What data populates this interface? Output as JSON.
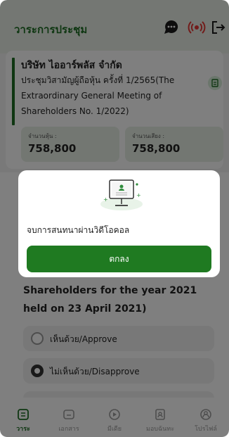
{
  "header": {
    "title": "วาระการประชุม"
  },
  "company": {
    "name": "บริษัท ไออาร์พลัส จำกัด",
    "meeting": "ประชุมวิสามัญผู้ถือหุ้น ครั้งที่ 1/2565(The Extraordinary General Meeting of Shareholders No. 1/2022)"
  },
  "stats": [
    {
      "label": "จำนวนหุ้น :",
      "value": "758,800"
    },
    {
      "label": "จำนวนเสียง :",
      "value": "758,800"
    }
  ],
  "agenda": {
    "text": "Shareholders for the year 2021 held on 23 April 2021)",
    "options": [
      {
        "label": "เห็นด้วย/Approve",
        "selected": false
      },
      {
        "label": "ไม่เห็นด้วย/Disapprove",
        "selected": true
      }
    ]
  },
  "dialog": {
    "message": "จบการสนทนาผ่านวิดีโอคอล",
    "ok_label": "ตกลง"
  },
  "nav": [
    {
      "label": "วาระ",
      "icon": "agenda-icon",
      "active": true
    },
    {
      "label": "เอกสาร",
      "icon": "document-icon",
      "active": false
    },
    {
      "label": "มีเดีย",
      "icon": "media-icon",
      "active": false
    },
    {
      "label": "มอบฉันทะ",
      "icon": "proxy-icon",
      "active": false
    },
    {
      "label": "โปรไฟล์",
      "icon": "profile-icon",
      "active": false
    }
  ],
  "colors": {
    "primary": "#1f6e25",
    "button": "#1f7a21",
    "live": "#e53935"
  }
}
